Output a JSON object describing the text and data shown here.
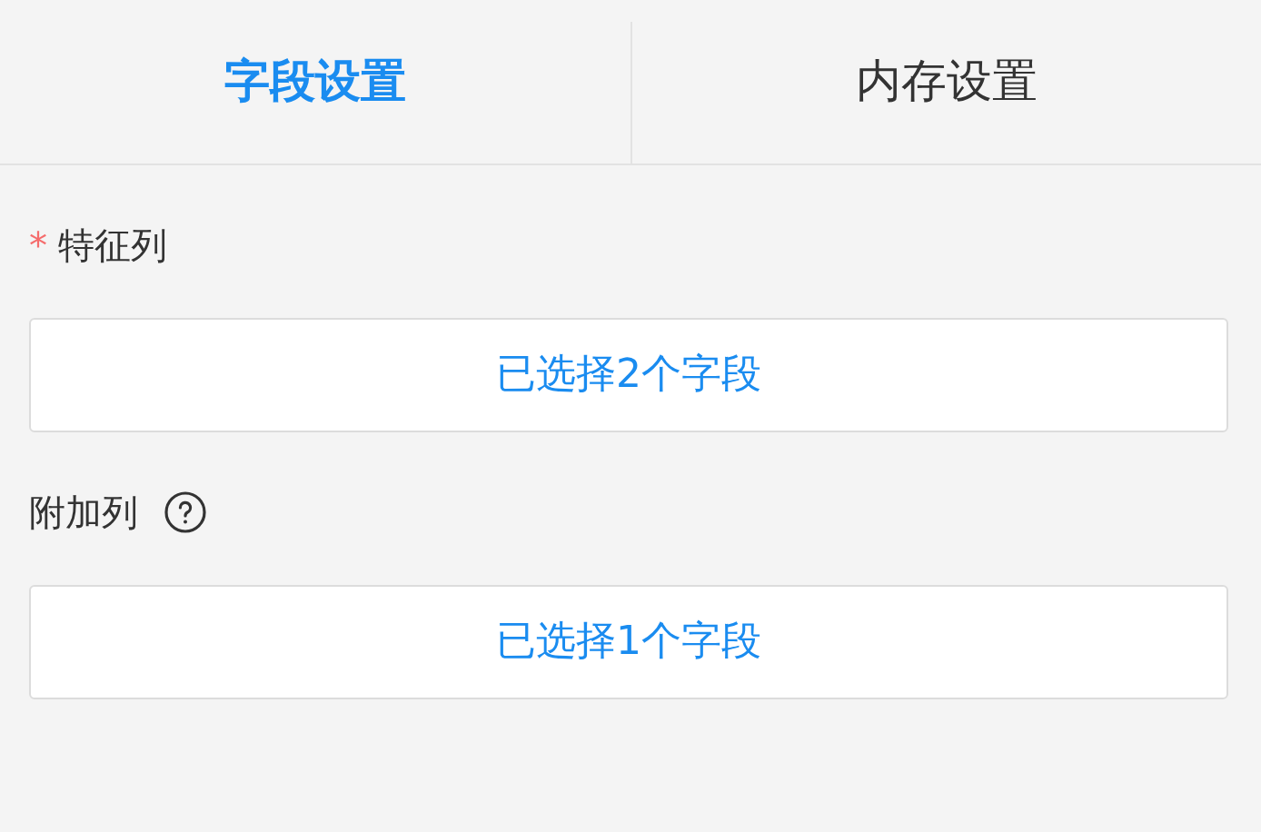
{
  "tabs": [
    {
      "label": "字段设置",
      "selected": true
    },
    {
      "label": "内存设置",
      "selected": false
    }
  ],
  "fields": [
    {
      "marker": "*",
      "label": "特征列",
      "help": false,
      "button": "已选择2个字段"
    },
    {
      "label": "附加列",
      "help": true,
      "button": "已选择1个字段"
    }
  ]
}
